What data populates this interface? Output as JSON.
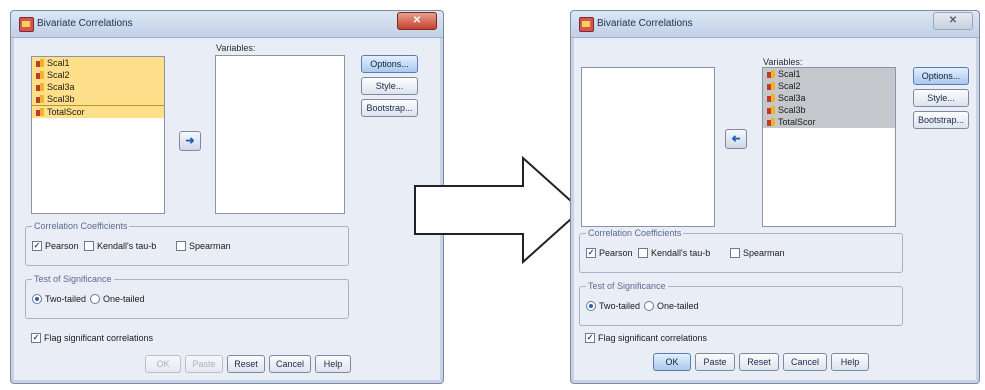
{
  "left_dialog": {
    "title": "Bivariate Correlations",
    "source_list": [
      "Scal1",
      "Scal2",
      "Scal3a",
      "Scal3b",
      "TotalScor"
    ],
    "variables_label": "Variables:",
    "move_arrow": "➜",
    "buttons": {
      "options": "Options...",
      "style": "Style...",
      "bootstrap": "Bootstrap..."
    },
    "correlation_group": "Correlation Coefficients",
    "pearson": "Pearson",
    "kendall": "Kendall's tau-b",
    "spearman": "Spearman",
    "significance_group": "Test of Significance",
    "two_tailed": "Two-tailed",
    "one_tailed": "One-tailed",
    "flag": "Flag significant correlations",
    "footer": {
      "ok": "OK",
      "paste": "Paste",
      "reset": "Reset",
      "cancel": "Cancel",
      "help": "Help"
    }
  },
  "right_dialog": {
    "title": "Bivariate Correlations",
    "variables_label": "Variables:",
    "target_list": [
      "Scal1",
      "Scal2",
      "Scal3a",
      "Scal3b",
      "TotalScor"
    ],
    "move_arrow": "➜",
    "buttons": {
      "options": "Options...",
      "style": "Style...",
      "bootstrap": "Bootstrap..."
    },
    "correlation_group": "Correlation Coefficients",
    "pearson": "Pearson",
    "kendall": "Kendall's tau-b",
    "spearman": "Spearman",
    "significance_group": "Test of Significance",
    "two_tailed": "Two-tailed",
    "one_tailed": "One-tailed",
    "flag": "Flag significant correlations",
    "footer": {
      "ok": "OK",
      "paste": "Paste",
      "reset": "Reset",
      "cancel": "Cancel",
      "help": "Help"
    }
  },
  "colors": {
    "selection_yellow": "#ffe08a",
    "selection_gray": "#c4c7cc",
    "close_red": "#c6402e"
  }
}
